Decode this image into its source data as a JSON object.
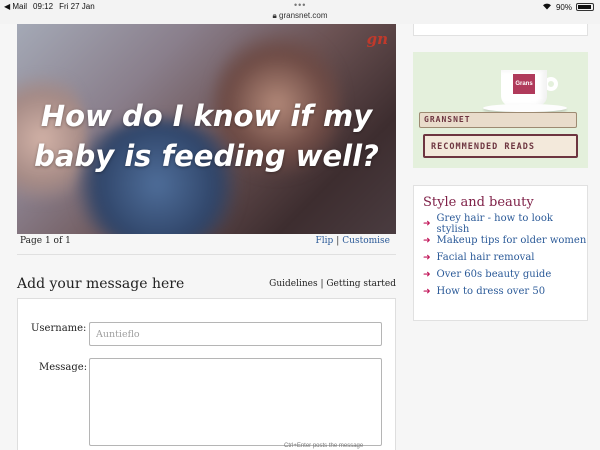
{
  "status_bar": {
    "back_app": "◀ Mail",
    "time": "09:12",
    "date": "Fri 27 Jan",
    "url": "gransnet.com",
    "battery": "90%"
  },
  "hero": {
    "line1": "How do I know if my",
    "line2": "baby is feeding well?",
    "logo": "gn"
  },
  "pagination": {
    "page_info": "Page 1 of 1",
    "flip": "Flip",
    "separator": "|",
    "customise": "Customise"
  },
  "add_message": {
    "title": "Add your message here",
    "links": "Guidelines | Getting started",
    "username_label": "Username:",
    "username_placeholder": "Auntieflo",
    "message_label": "Message:",
    "hint": "Ctrl+Enter posts the message"
  },
  "promo": {
    "cup_logo": "Grans",
    "book1": "GRANSNET",
    "book2": "RECOMMENDED READS"
  },
  "sidebar": {
    "title": "Style and beauty",
    "items": [
      "Grey hair - how to look stylish",
      "Makeup tips for older women",
      "Facial hair removal",
      "Over 60s beauty guide",
      "How to dress over 50"
    ]
  }
}
